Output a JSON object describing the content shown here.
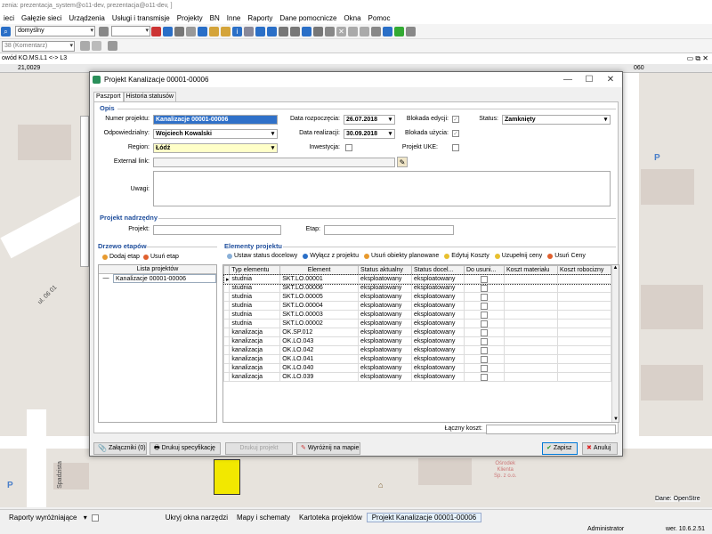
{
  "app": {
    "title": "zenia: prezentacja_system@o11-dev, prezentacja@o11-dev, ]",
    "menu": [
      "ieci",
      "Gałęzie sieci",
      "Urządzenia",
      "Usługi i transmisje",
      "Projekty",
      "BN",
      "Inne",
      "Raporty",
      "Dane pomocnicze",
      "Okna",
      "Pomoc"
    ],
    "toolbar": {
      "scheme_value": "domyślny",
      "layer_value": "38 (Komentarz)"
    }
  },
  "map": {
    "header": "owód KO.MS.L1 <-> L3",
    "ruler_left": "21,0029",
    "ruler_right": "060",
    "street_labels": [
      "ul. 06 01",
      "Spadzista"
    ],
    "poi_labels": [
      "Ośrodek",
      "Klienta",
      "Sp. z o.o."
    ],
    "parking_label": "P",
    "copyright": "Dane: OpenStre"
  },
  "status_bar": {
    "reports_label": "Raporty wyróżniające",
    "items": [
      "Ukryj okna narzędzi",
      "Mapy i schematy",
      "Kartoteka projektów",
      "Projekt Kanalizacje 00001-00006"
    ],
    "user": "Administrator",
    "version": "wer. 10.6.2.51"
  },
  "dialog": {
    "title": "Projekt Kanalizacje 00001-00006",
    "tabs": [
      "Paszport",
      "Historia statusów"
    ],
    "opis_section": "Opis",
    "fields": {
      "numer_label": "Numer projektu:",
      "numer_value": "Kanalizacje 00001-00006",
      "odp_label": "Odpowiedzialny:",
      "odp_value": "Wojciech Kowalski",
      "region_label": "Region:",
      "region_value": "Łódź",
      "ext_label": "External link:",
      "ext_value": "",
      "uwagi_label": "Uwagi:",
      "uwagi_value": "",
      "data_rozp_label": "Data rozpoczęcia:",
      "data_rozp_value": "26.07.2018",
      "data_real_label": "Data realizacji:",
      "data_real_value": "30.09.2018",
      "inwestycja_label": "Inwestycja:",
      "blok_edycji_label": "Blokada edycji:",
      "blok_uzycia_label": "Blokada użycia:",
      "uke_label": "Projekt UKE:",
      "status_label": "Status:",
      "status_value": "Zamknięty"
    },
    "nadrzedny_section": "Projekt nadrzędny",
    "projekt_label": "Projekt:",
    "projekt_value": "",
    "etap_label": "Etap:",
    "etap_value": "",
    "drzewo_section": "Drzewo etapów",
    "drzewo_buttons": [
      "Dodaj etap",
      "Usuń etap"
    ],
    "drzewo_header": "Lista projektów",
    "drzewo_items": [
      {
        "expander": "—",
        "label": "Kanalizacje 00001-00006"
      }
    ],
    "elementy_section": "Elementy projektu",
    "elementy_toolbar": [
      "Ustaw status docelowy",
      "Wyłącz z projektu",
      "Usuń obiekty planowane",
      "Edytuj Koszty",
      "Uzupełnij ceny",
      "Usuń Ceny"
    ],
    "columns": [
      "Typ elementu",
      "Element",
      "Status aktualny",
      "Status docel...",
      "Do usuni...",
      "Koszt materiału",
      "Koszt robocizny"
    ],
    "rows": [
      {
        "typ": "studnia",
        "element": "SKT.LO.00001",
        "status": "eksploatowany",
        "docelowy": "eksploatowany"
      },
      {
        "typ": "studnia",
        "element": "SKT.LO.00006",
        "status": "eksploatowany",
        "docelowy": "eksploatowany"
      },
      {
        "typ": "studnia",
        "element": "SKT.LO.00005",
        "status": "eksploatowany",
        "docelowy": "eksploatowany"
      },
      {
        "typ": "studnia",
        "element": "SKT.LO.00004",
        "status": "eksploatowany",
        "docelowy": "eksploatowany"
      },
      {
        "typ": "studnia",
        "element": "SKT.LO.00003",
        "status": "eksploatowany",
        "docelowy": "eksploatowany"
      },
      {
        "typ": "studnia",
        "element": "SKT.LO.00002",
        "status": "eksploatowany",
        "docelowy": "eksploatowany"
      },
      {
        "typ": "kanalizacja",
        "element": "OK.SP.012",
        "status": "eksploatowany",
        "docelowy": "eksploatowany"
      },
      {
        "typ": "kanalizacja",
        "element": "OK.LO.043",
        "status": "eksploatowany",
        "docelowy": "eksploatowany"
      },
      {
        "typ": "kanalizacja",
        "element": "OK.LO.042",
        "status": "eksploatowany",
        "docelowy": "eksploatowany"
      },
      {
        "typ": "kanalizacja",
        "element": "OK.LO.041",
        "status": "eksploatowany",
        "docelowy": "eksploatowany"
      },
      {
        "typ": "kanalizacja",
        "element": "OK.LO.040",
        "status": "eksploatowany",
        "docelowy": "eksploatowany"
      },
      {
        "typ": "kanalizacja",
        "element": "OK.LO.039",
        "status": "eksploatowany",
        "docelowy": "eksploatowany"
      }
    ],
    "koszt_label": "Łączny koszt:",
    "koszt_value": "",
    "footer": {
      "zalaczniki": "Załączniki (0)",
      "drukuj_spec": "Drukuj specyfikację",
      "drukuj_proj": "Drukuj projekt",
      "wyroznij": "Wyróżnij na mapie",
      "zapisz": "Zapisz",
      "anuluj": "Anuluj"
    }
  },
  "colors": {
    "accent": "#3071c9",
    "section": "#1f4e9c",
    "required": "#ffffc8"
  }
}
